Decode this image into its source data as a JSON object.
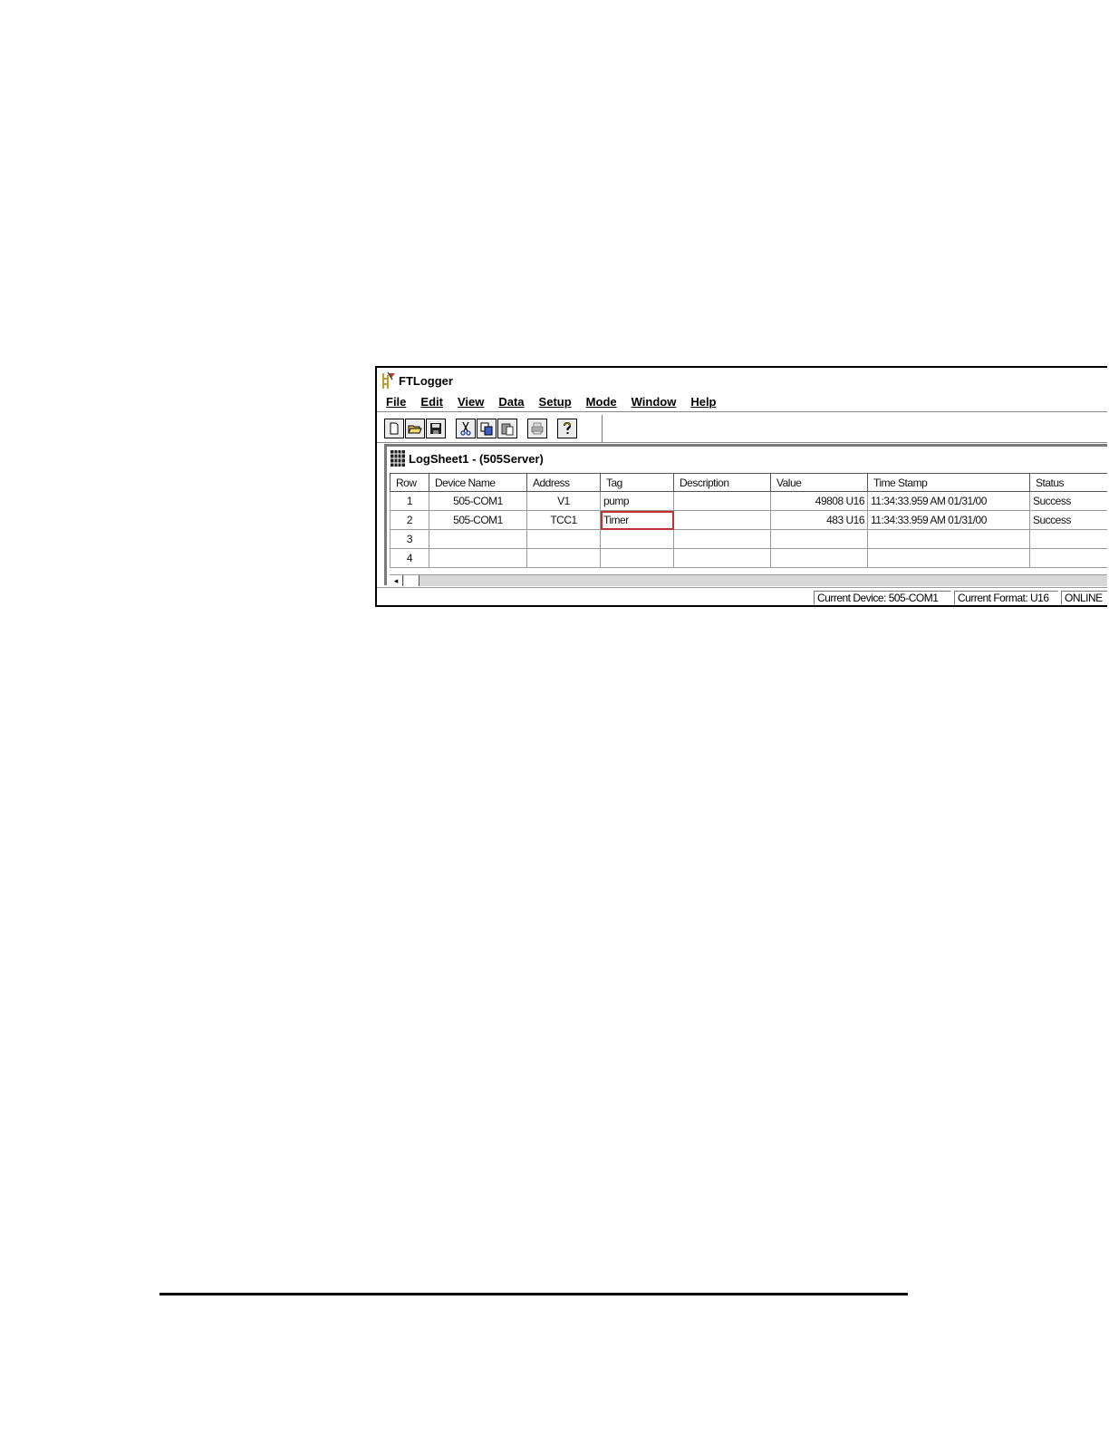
{
  "app": {
    "title": "FTLogger"
  },
  "menu": {
    "items": [
      "File",
      "Edit",
      "View",
      "Data",
      "Setup",
      "Mode",
      "Window",
      "Help"
    ]
  },
  "toolbar": {
    "buttons": [
      {
        "icon": "new-file-icon"
      },
      {
        "icon": "open-folder-icon"
      },
      {
        "icon": "save-icon"
      },
      {
        "icon": "cut-icon"
      },
      {
        "icon": "copy-icon"
      },
      {
        "icon": "paste-icon"
      },
      {
        "icon": "print-icon"
      },
      {
        "icon": "help-icon"
      }
    ]
  },
  "logsheet": {
    "title": "LogSheet1 - (505Server)",
    "columns": [
      "Row",
      "Device Name",
      "Address",
      "Tag",
      "Description",
      "Value",
      "Time Stamp",
      "Status"
    ],
    "rows": [
      {
        "row": "1",
        "device": "505-COM1",
        "address": "V1",
        "tag": "pump",
        "description": "",
        "value": "49808 U16",
        "timestamp": "11:34:33.959 AM  01/31/00",
        "status": "Success"
      },
      {
        "row": "2",
        "device": "505-COM1",
        "address": "TCC1",
        "tag": "Timer",
        "description": "",
        "value": "483 U16",
        "timestamp": "11:34:33.959 AM  01/31/00",
        "status": "Success"
      },
      {
        "row": "3",
        "device": "",
        "address": "",
        "tag": "",
        "description": "",
        "value": "",
        "timestamp": "",
        "status": ""
      },
      {
        "row": "4",
        "device": "",
        "address": "",
        "tag": "",
        "description": "",
        "value": "",
        "timestamp": "",
        "status": ""
      }
    ],
    "selected_cell": {
      "row": 2,
      "column": "Tag"
    }
  },
  "statusbar": {
    "device": "Current Device: 505-COM1",
    "format": "Current Format: U16",
    "mode": "ONLINE"
  },
  "colors": {
    "selection_border": "#c43131",
    "frame": "#000000"
  }
}
